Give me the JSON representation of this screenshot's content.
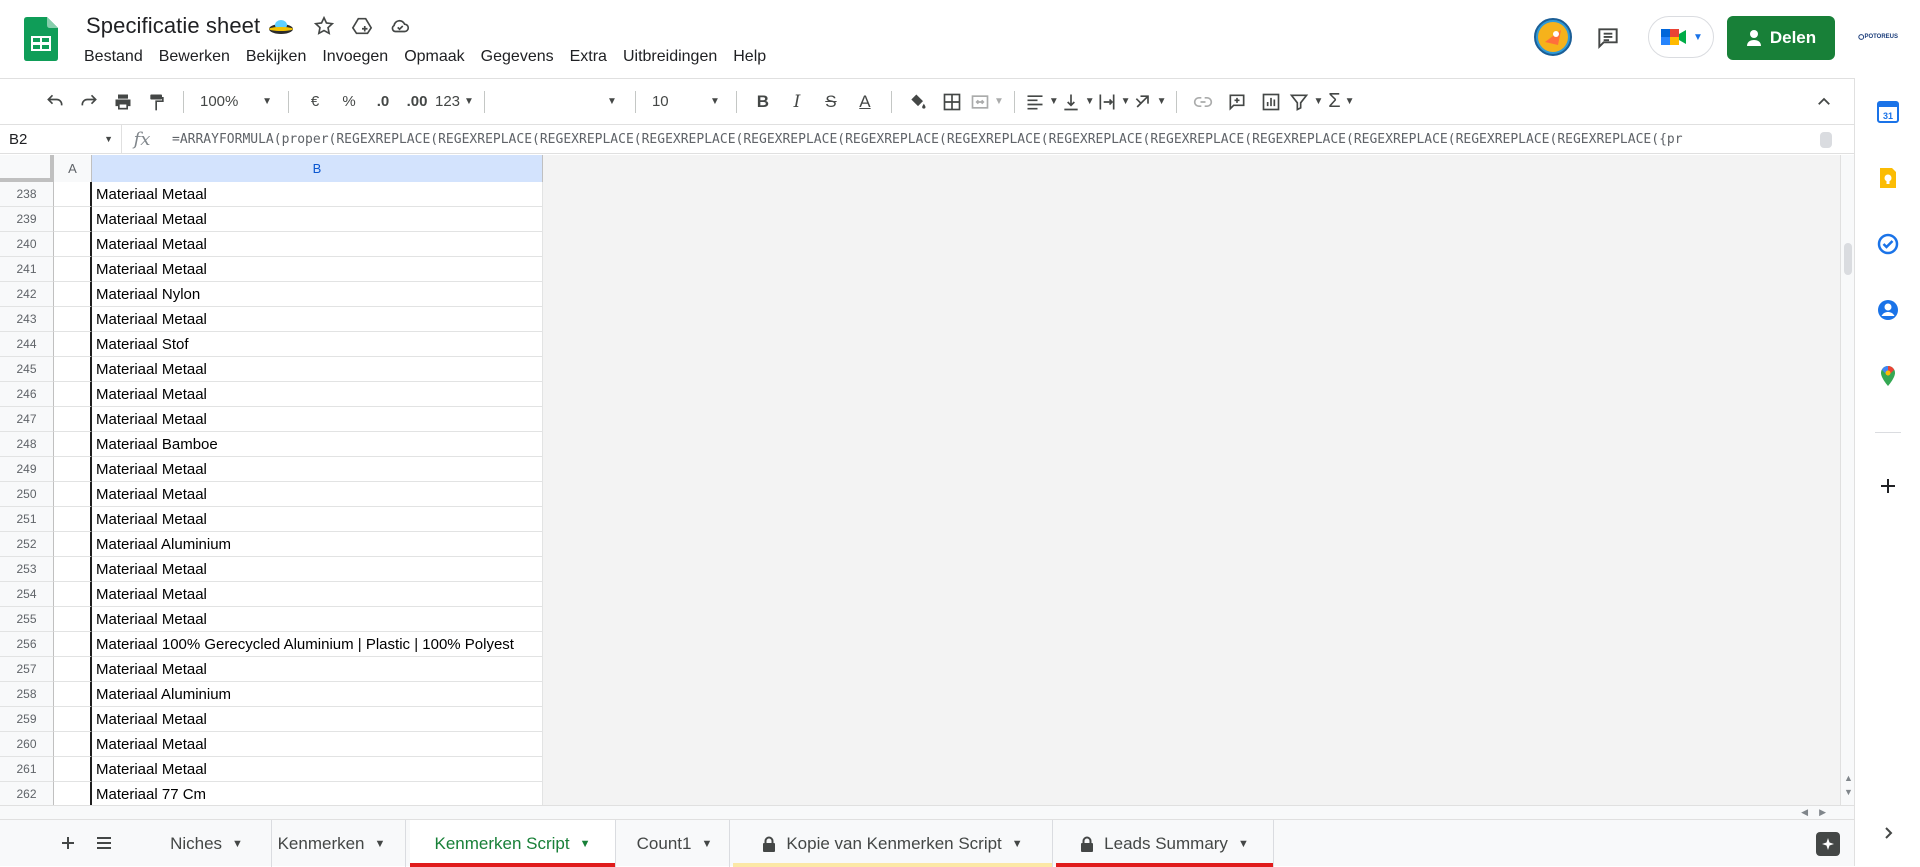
{
  "header": {
    "title": "Specificatie sheet",
    "menu": [
      "Bestand",
      "Bewerken",
      "Bekijken",
      "Invoegen",
      "Opmaak",
      "Gegevens",
      "Extra",
      "Uitbreidingen",
      "Help"
    ],
    "share_label": "Delen",
    "org_logo_text": "POTOREUS"
  },
  "toolbar": {
    "zoom": "100%",
    "currency": "€",
    "percent": "%",
    "dec_decrease": ".0",
    "dec_increase": ".00",
    "format_more": "123",
    "font": "",
    "font_size": "10"
  },
  "formula_bar": {
    "name_box": "B2",
    "fx": "fx",
    "formula": "=ARRAYFORMULA(proper(REGEXREPLACE(REGEXREPLACE(REGEXREPLACE(REGEXREPLACE(REGEXREPLACE(REGEXREPLACE(REGEXREPLACE(REGEXREPLACE(REGEXREPLACE(REGEXREPLACE(REGEXREPLACE(REGEXREPLACE(REGEXREPLACE({pr"
  },
  "grid": {
    "columns": [
      "A",
      "B"
    ],
    "rows": [
      {
        "n": "238",
        "b": "Materiaal Metaal"
      },
      {
        "n": "239",
        "b": "Materiaal Metaal"
      },
      {
        "n": "240",
        "b": "Materiaal Metaal"
      },
      {
        "n": "241",
        "b": "Materiaal Metaal"
      },
      {
        "n": "242",
        "b": "Materiaal Nylon"
      },
      {
        "n": "243",
        "b": "Materiaal Metaal"
      },
      {
        "n": "244",
        "b": "Materiaal Stof"
      },
      {
        "n": "245",
        "b": "Materiaal Metaal"
      },
      {
        "n": "246",
        "b": "Materiaal Metaal"
      },
      {
        "n": "247",
        "b": "Materiaal Metaal"
      },
      {
        "n": "248",
        "b": "Materiaal Bamboe"
      },
      {
        "n": "249",
        "b": "Materiaal Metaal"
      },
      {
        "n": "250",
        "b": "Materiaal Metaal"
      },
      {
        "n": "251",
        "b": "Materiaal Metaal"
      },
      {
        "n": "252",
        "b": "Materiaal Aluminium"
      },
      {
        "n": "253",
        "b": "Materiaal Metaal"
      },
      {
        "n": "254",
        "b": "Materiaal Metaal"
      },
      {
        "n": "255",
        "b": "Materiaal Metaal"
      },
      {
        "n": "256",
        "b": "Materiaal 100% Gerecycled Aluminium | Plastic | 100% Polyest"
      },
      {
        "n": "257",
        "b": "Materiaal Metaal"
      },
      {
        "n": "258",
        "b": "Materiaal Aluminium"
      },
      {
        "n": "259",
        "b": "Materiaal Metaal"
      },
      {
        "n": "260",
        "b": "Materiaal Metaal"
      },
      {
        "n": "261",
        "b": "Materiaal Metaal"
      },
      {
        "n": "262",
        "b": "Materiaal 77 Cm"
      }
    ]
  },
  "sheets": [
    {
      "label": "Niches",
      "locked": false,
      "active": false,
      "color": ""
    },
    {
      "label": "Kenmerken",
      "locked": false,
      "active": false,
      "color": ""
    },
    {
      "label": "Kenmerken Script",
      "locked": false,
      "active": true,
      "color": "#e01b1b"
    },
    {
      "label": "Count1",
      "locked": false,
      "active": false,
      "color": ""
    },
    {
      "label": "Kopie van Kenmerken Script",
      "locked": true,
      "active": false,
      "color": "#fce8a6"
    },
    {
      "label": "Leads Summary",
      "locked": true,
      "active": false,
      "color": "#e01b1b"
    }
  ],
  "side_panel": {
    "apps": [
      "calendar-icon",
      "keep-icon",
      "tasks-icon",
      "contacts-icon",
      "maps-icon"
    ],
    "calendar_day": "31"
  },
  "colors": {
    "sheets_green": "#188038",
    "active_tab_text": "#188038",
    "selected_col_header": "#d3e3fd"
  }
}
